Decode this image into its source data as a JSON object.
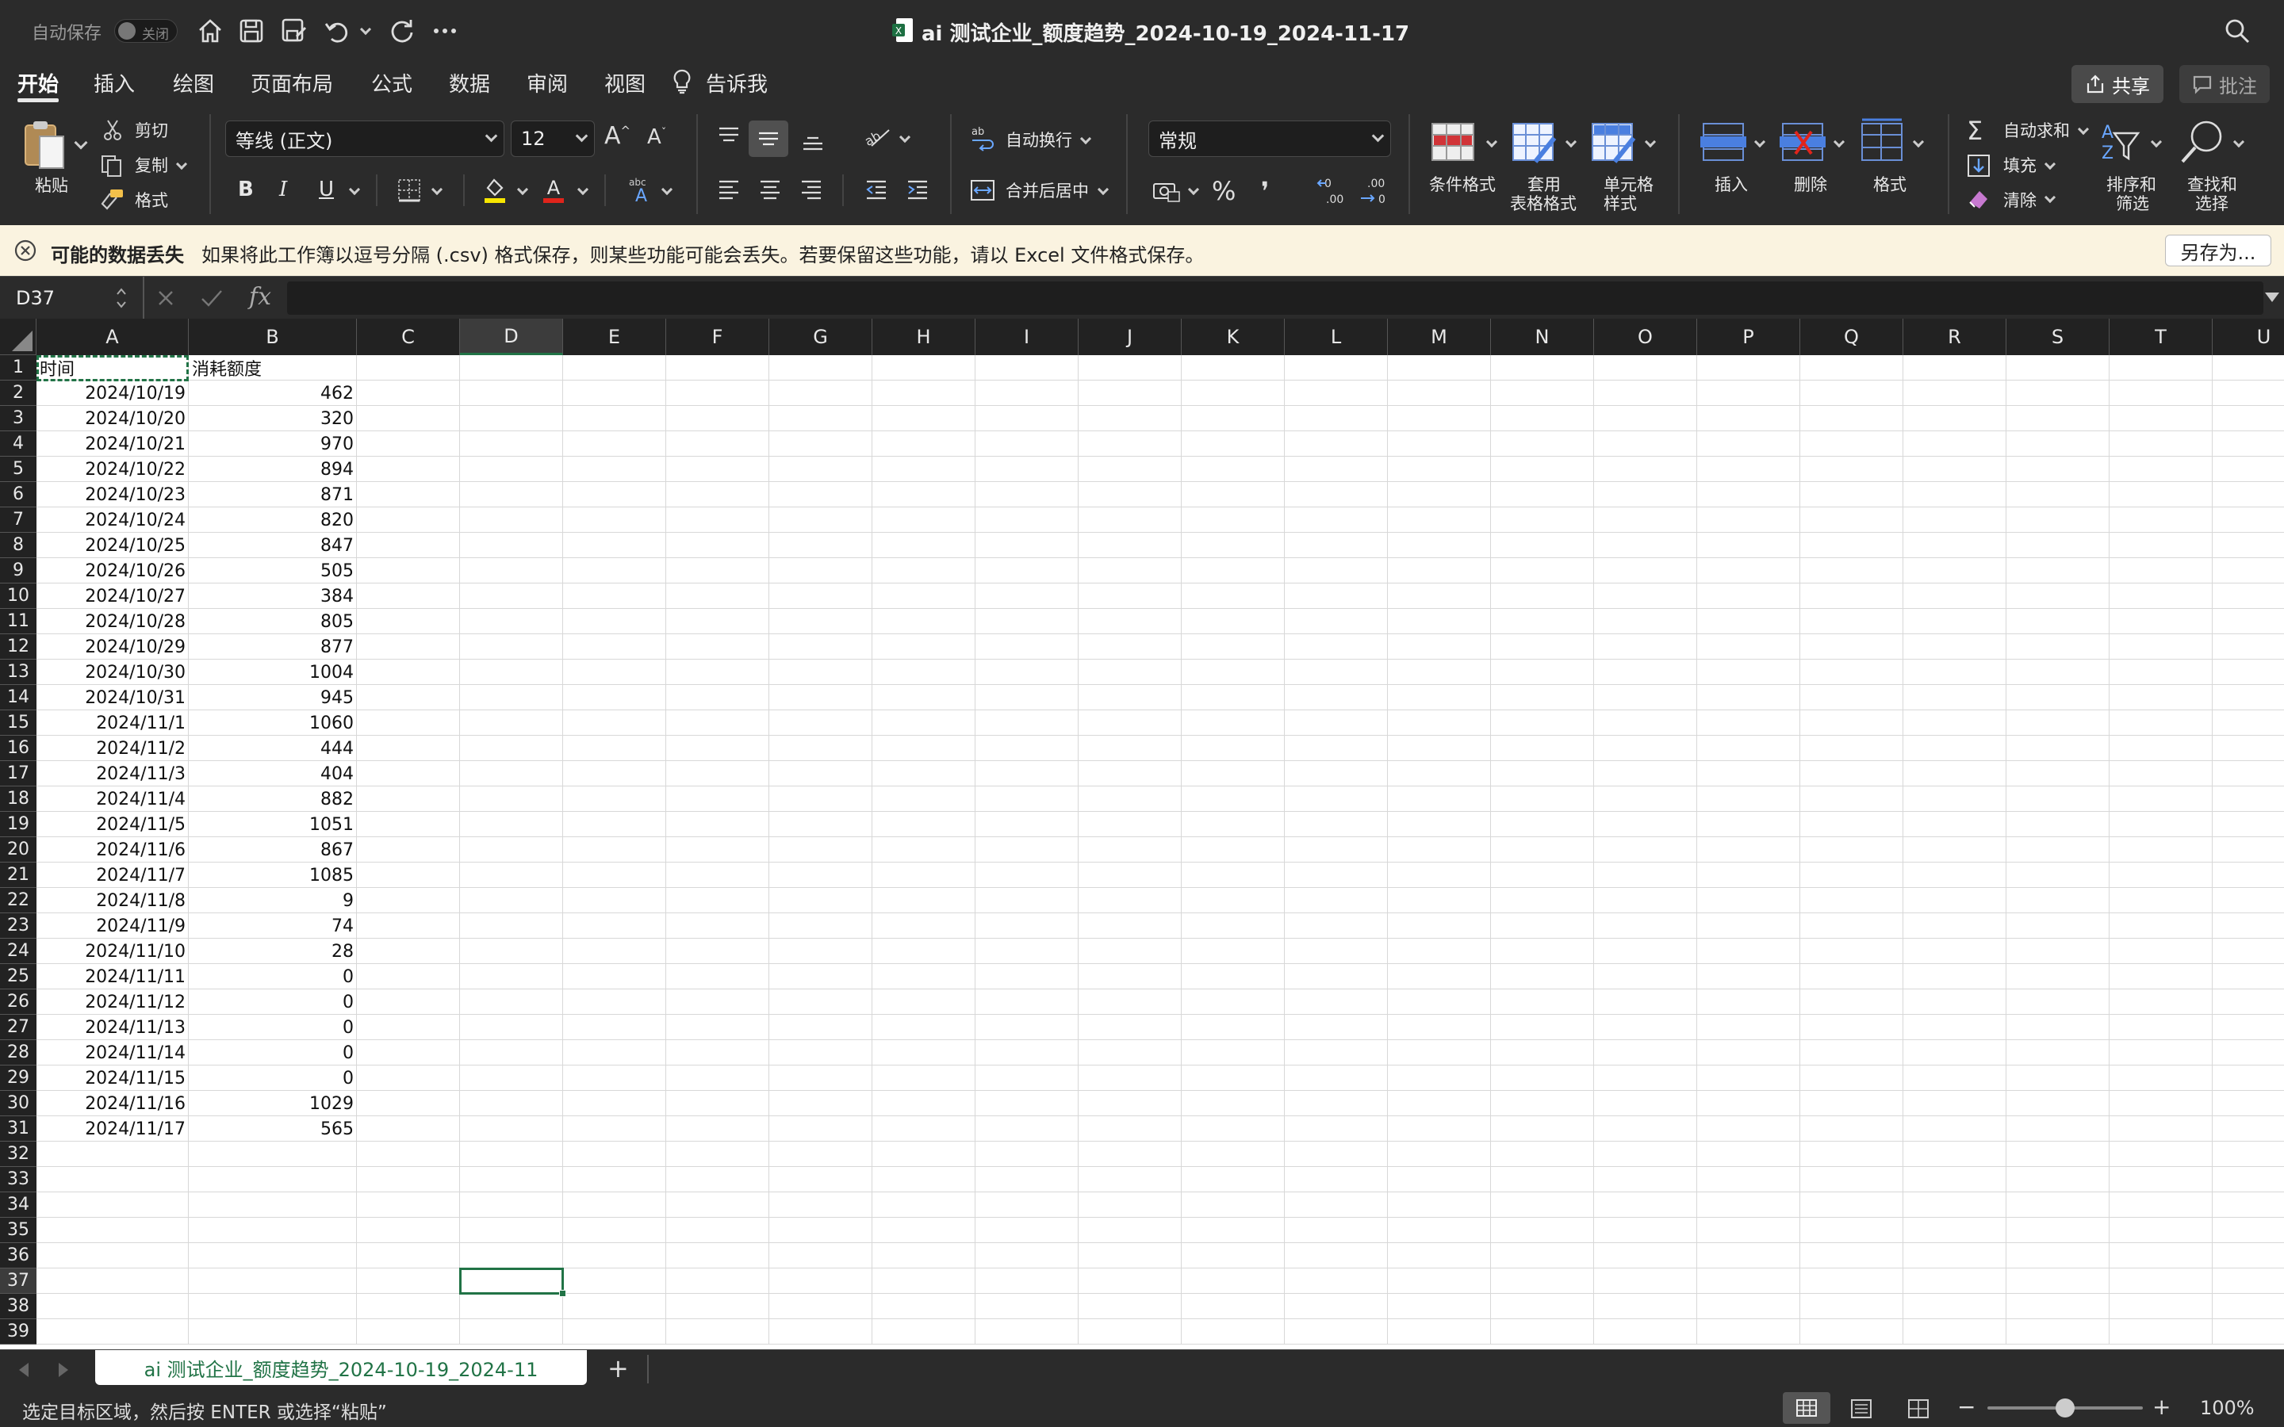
{
  "titlebar": {
    "autosave_label": "自动保存",
    "autosave_state": "关闭",
    "doc_title": "ai 测试企业_额度趋势_2024-10-19_2024-11-17"
  },
  "tabs": [
    "开始",
    "插入",
    "绘图",
    "页面布局",
    "公式",
    "数据",
    "审阅",
    "视图"
  ],
  "tell_me": "告诉我",
  "share_label": "共享",
  "comments_label": "批注",
  "ribbon": {
    "paste": "粘贴",
    "cut": "剪切",
    "copy": "复制",
    "format_painter": "格式",
    "font_name": "等线 (正文)",
    "font_size": "12",
    "bold": "B",
    "italic": "I",
    "underline": "U",
    "wrap_text": "自动换行",
    "merge_center": "合并后居中",
    "number_format": "常规",
    "percent": "%",
    "comma": "❜",
    "conditional_format": "条件格式",
    "table_format_l1": "套用",
    "table_format_l2": "表格格式",
    "cell_style_l1": "单元格",
    "cell_style_l2": "样式",
    "insert": "插入",
    "delete": "删除",
    "format": "格式",
    "autosum": "自动求和",
    "fill": "填充",
    "clear": "清除",
    "sort_l1": "排序和",
    "sort_l2": "筛选",
    "find_l1": "查找和",
    "find_l2": "选择"
  },
  "message": {
    "title": "可能的数据丢失",
    "text": "如果将此工作簿以逗号分隔 (.csv) 格式保存，则某些功能可能会丢失。若要保留这些功能，请以 Excel 文件格式保存。",
    "button": "另存为..."
  },
  "formula_bar": {
    "name_box": "D37",
    "fx": "fx",
    "formula": ""
  },
  "columns": [
    "A",
    "B",
    "C",
    "D",
    "E",
    "F",
    "G",
    "H",
    "I",
    "J",
    "K",
    "L",
    "M",
    "N",
    "O",
    "P",
    "Q",
    "R",
    "S",
    "T",
    "U"
  ],
  "header_row": [
    "时间",
    "消耗额度"
  ],
  "rows": [
    [
      "2024/10/19",
      "462"
    ],
    [
      "2024/10/20",
      "320"
    ],
    [
      "2024/10/21",
      "970"
    ],
    [
      "2024/10/22",
      "894"
    ],
    [
      "2024/10/23",
      "871"
    ],
    [
      "2024/10/24",
      "820"
    ],
    [
      "2024/10/25",
      "847"
    ],
    [
      "2024/10/26",
      "505"
    ],
    [
      "2024/10/27",
      "384"
    ],
    [
      "2024/10/28",
      "805"
    ],
    [
      "2024/10/29",
      "877"
    ],
    [
      "2024/10/30",
      "1004"
    ],
    [
      "2024/10/31",
      "945"
    ],
    [
      "2024/11/1",
      "1060"
    ],
    [
      "2024/11/2",
      "444"
    ],
    [
      "2024/11/3",
      "404"
    ],
    [
      "2024/11/4",
      "882"
    ],
    [
      "2024/11/5",
      "1051"
    ],
    [
      "2024/11/6",
      "867"
    ],
    [
      "2024/11/7",
      "1085"
    ],
    [
      "2024/11/8",
      "9"
    ],
    [
      "2024/11/9",
      "74"
    ],
    [
      "2024/11/10",
      "28"
    ],
    [
      "2024/11/11",
      "0"
    ],
    [
      "2024/11/12",
      "0"
    ],
    [
      "2024/11/13",
      "0"
    ],
    [
      "2024/11/14",
      "0"
    ],
    [
      "2024/11/15",
      "0"
    ],
    [
      "2024/11/16",
      "1029"
    ],
    [
      "2024/11/17",
      "565"
    ]
  ],
  "row_count": 39,
  "selected_cell": {
    "col": "D",
    "row": 37
  },
  "sheet_tab": "ai 测试企业_额度趋势_2024-10-19_2024-11",
  "add_sheet": "+",
  "status": {
    "text": "选定目标区域，然后按 ENTER 或选择“粘贴”",
    "zoom": "100%",
    "zoom_minus": "−",
    "zoom_plus": "+",
    "zoom_level": 0.5
  },
  "colors": {
    "chrome_bg": "#2b2b2b",
    "selection": "#217346",
    "header_bg": "#222222"
  }
}
